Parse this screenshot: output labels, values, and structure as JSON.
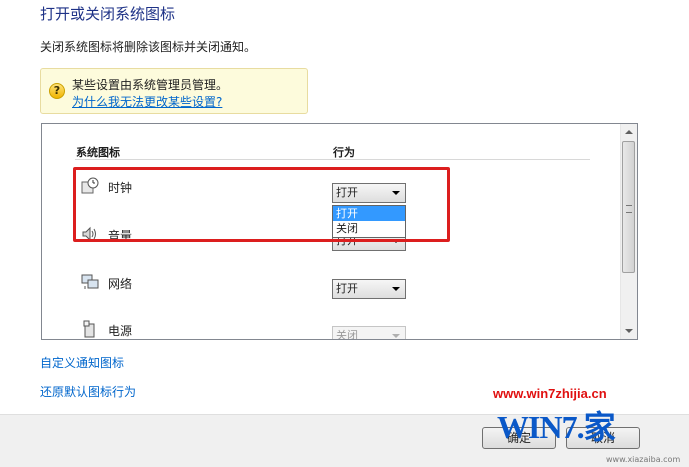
{
  "title": "打开或关闭系统图标",
  "description": "关闭系统图标将删除该图标并关闭通知。",
  "notice": {
    "text": "某些设置由系统管理员管理。",
    "link": "为什么我无法更改某些设置?"
  },
  "table": {
    "col_icon": "系统图标",
    "col_behavior": "行为",
    "rows": [
      {
        "icon": "clock-icon",
        "label": "时钟",
        "value": "打开",
        "enabled": true
      },
      {
        "icon": "volume-icon",
        "label": "音量",
        "value": "打开",
        "enabled": true
      },
      {
        "icon": "network-icon",
        "label": "网络",
        "value": "打开",
        "enabled": true
      },
      {
        "icon": "power-icon",
        "label": "电源",
        "value": "关闭",
        "enabled": false
      }
    ]
  },
  "dropdown": {
    "options": [
      "打开",
      "关闭"
    ],
    "selected": "打开"
  },
  "links": {
    "customize": "自定义通知图标",
    "restore": "还原默认图标行为"
  },
  "buttons": {
    "ok": "确定",
    "cancel": "取消"
  },
  "watermark": {
    "url": "www.win7zhijia.cn",
    "logo": "WIN7.家",
    "sub": "www.xiazaiba.com"
  },
  "colors": {
    "title": "#1e3287",
    "link": "#0066cc",
    "highlight_border": "#dc1e1e",
    "dropdown_selected": "#3399ff"
  }
}
